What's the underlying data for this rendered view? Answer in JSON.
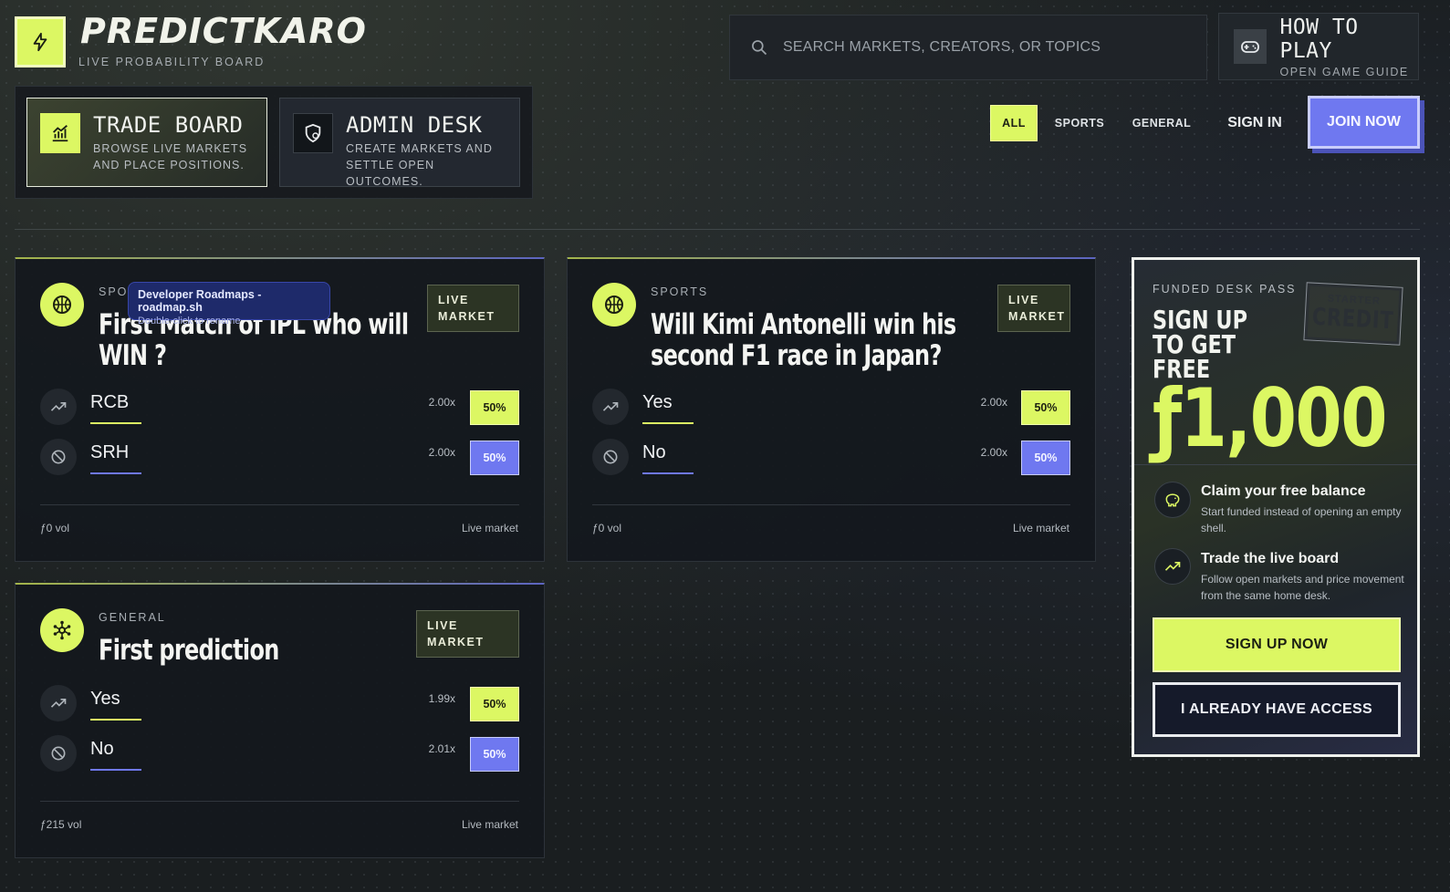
{
  "brand": {
    "title": "PREDICTKARO",
    "subtitle": "LIVE PROBABILITY BOARD",
    "logo_icon": "bolt-icon"
  },
  "modes": [
    {
      "title": "TRADE BOARD",
      "line1": "BROWSE LIVE MARKETS",
      "line2": "AND PLACE POSITIONS.",
      "icon": "chart-icon"
    },
    {
      "title": "ADMIN DESK",
      "line1": "CREATE MARKETS AND",
      "line2": "SETTLE OPEN OUTCOMES.",
      "icon": "shield-icon"
    }
  ],
  "search": {
    "placeholder": "SEARCH MARKETS, CREATORS, OR TOPICS"
  },
  "howto": {
    "title": "HOW TO PLAY",
    "subtitle": "OPEN GAME GUIDE"
  },
  "filters": [
    {
      "label": "ALL",
      "active": true
    },
    {
      "label": "SPORTS",
      "active": false
    },
    {
      "label": "GENERAL",
      "active": false
    }
  ],
  "auth": {
    "signin": "SIGN IN",
    "join": "JOIN NOW"
  },
  "tooltip": {
    "title": "Developer Roadmaps - roadmap.sh",
    "subtitle": "Double-click to rename"
  },
  "markets": [
    {
      "category": "SPORTS",
      "title_line1": "First Match of IPL who will",
      "title_line2": "WIN ?",
      "badge_line1": "LIVE",
      "badge_line2": "MARKET",
      "options": [
        {
          "label": "RCB",
          "multiplier": "2.00x",
          "percent": "50%"
        },
        {
          "label": "SRH",
          "multiplier": "2.00x",
          "percent": "50%"
        }
      ],
      "volume": "ƒ0 vol",
      "status": "Live market"
    },
    {
      "category": "SPORTS",
      "title_line1": "Will Kimi Antonelli win his",
      "title_line2": "second F1 race in Japan?",
      "badge_line1": "LIVE",
      "badge_line2": "MARKET",
      "options": [
        {
          "label": "Yes",
          "multiplier": "2.00x",
          "percent": "50%"
        },
        {
          "label": "No",
          "multiplier": "2.00x",
          "percent": "50%"
        }
      ],
      "volume": "ƒ0 vol",
      "status": "Live market"
    },
    {
      "category": "GENERAL",
      "title_line1": "First prediction",
      "badge": "LIVE MARKET",
      "options": [
        {
          "label": "Yes",
          "multiplier": "1.99x",
          "percent": "50%"
        },
        {
          "label": "No",
          "multiplier": "2.01x",
          "percent": "50%"
        }
      ],
      "volume": "ƒ215 vol",
      "status": "Live market"
    }
  ],
  "promo": {
    "kicker": "FUNDED DESK PASS",
    "head1": "SIGN UP",
    "head2": "TO GET",
    "head3": "FREE",
    "amount": "ƒ1,000",
    "stamp_small": "STARTER",
    "stamp_big": "CREDIT",
    "perks": [
      {
        "title": "Claim your free balance",
        "desc": "Start funded instead of opening an empty shell."
      },
      {
        "title": "Trade the live board",
        "desc": "Follow open markets and price movement from the same home desk."
      }
    ],
    "primary_cta": "SIGN UP NOW",
    "secondary_cta": "I ALREADY HAVE ACCESS"
  },
  "colors": {
    "accent": "#dcf763",
    "no_accent": "#6f78f0",
    "background": "#1a1e20"
  }
}
